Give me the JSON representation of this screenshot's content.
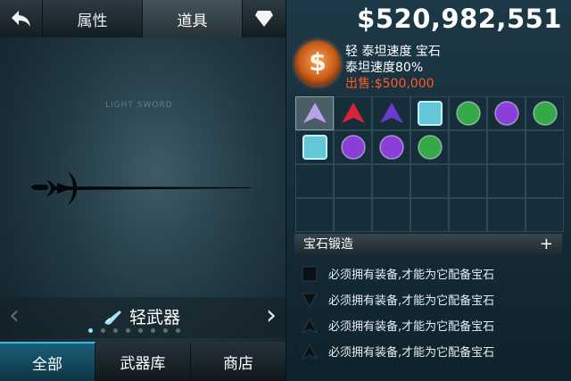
{
  "tabs": {
    "back_icon": "back-arrow-icon",
    "attributes": "属性",
    "items": "道具",
    "gem_icon": "diamond-icon"
  },
  "ghost_text": "LIGHT SWORD",
  "navigator": {
    "category": "轻武器",
    "page_count": 8,
    "active_page": 1
  },
  "bottom_tabs": [
    "全部",
    "武器库",
    "商店"
  ],
  "money": "$520,982,551",
  "selected": {
    "line1": "轻 泰坦速度 宝石",
    "line2": "泰坦速度80%",
    "price": "出售:$500,000",
    "orb_glyph": "$"
  },
  "gems": [
    {
      "type": "tri",
      "color": "#b7a0e6"
    },
    {
      "type": "tri",
      "color": "#d8233a"
    },
    {
      "type": "tri",
      "color": "#6a3ad0"
    },
    {
      "type": "square",
      "color": "#63c7d8"
    },
    {
      "type": "round",
      "color": "#35a84a"
    },
    {
      "type": "round",
      "color": "#8b3ed8"
    },
    {
      "type": "round",
      "color": "#35a84a"
    },
    {
      "type": "square",
      "color": "#63c7d8"
    },
    {
      "type": "round",
      "color": "#8b3ed8"
    },
    {
      "type": "round",
      "color": "#8b3ed8"
    },
    {
      "type": "round",
      "color": "#35a84a"
    }
  ],
  "forge": {
    "label": "宝石锻造",
    "plus": "+"
  },
  "slots": [
    {
      "shape": "square",
      "text": "必须拥有装备,才能为它配备宝石"
    },
    {
      "shape": "down",
      "text": "必须拥有装备,才能为它配备宝石"
    },
    {
      "shape": "tri",
      "text": "必须拥有装备,才能为它配备宝石"
    },
    {
      "shape": "tri",
      "text": "必须拥有装备,才能为它配备宝石"
    }
  ]
}
